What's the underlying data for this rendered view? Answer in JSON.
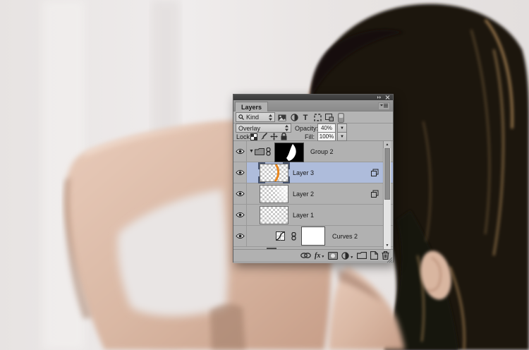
{
  "panel": {
    "tab": "Layers",
    "titlebar": {
      "collapse_icon": "double-arrow-icon",
      "close_icon": "x-icon"
    },
    "panel_menu_icon": "panel-menu-icon",
    "filter": {
      "kind_label": "Kind",
      "search_icon": "magnifier-icon",
      "type_filters": [
        "pixel-layers-filter",
        "adjustment-layers-filter",
        "type-layers-filter",
        "shape-layers-filter",
        "smart-objects-filter"
      ],
      "toggle_icon": "filtering-toggle"
    },
    "blend": {
      "mode": "Overlay"
    },
    "opacity": {
      "label": "Opacity:",
      "value": "40%"
    },
    "lock": {
      "label": "Lock:",
      "buttons": [
        "lock-transparent-pixels",
        "lock-image-pixels",
        "lock-position",
        "lock-all"
      ]
    },
    "fill": {
      "label": "Fill:",
      "value": "100%"
    },
    "layers": [
      {
        "name": "Group 2",
        "type": "group",
        "visible": true,
        "expanded": true,
        "mask": "black-with-white-profile",
        "mask_linked": true
      },
      {
        "name": "Layer 3",
        "type": "pixel",
        "visible": true,
        "selected": true,
        "has_badge": true,
        "thumbnail": "transparent-with-orange-stroke"
      },
      {
        "name": "Layer 2",
        "type": "pixel",
        "visible": true,
        "has_badge": true,
        "thumbnail": "transparent-faint-white"
      },
      {
        "name": "Layer 1",
        "type": "pixel",
        "visible": true,
        "has_badge": false,
        "thumbnail": "transparent"
      },
      {
        "name": "Curves 2",
        "type": "curves-adjustment",
        "visible": true,
        "mask": "white",
        "mask_linked": true
      }
    ],
    "bottom_toolbar": {
      "fx_label": "fx",
      "icons": [
        "link-layers",
        "layer-styles",
        "add-layer-mask",
        "new-adjustment-layer",
        "new-group",
        "new-layer",
        "delete-layer"
      ]
    }
  },
  "colors": {
    "selection_blue": "#aebcdb",
    "panel_gray": "#b1b1b1",
    "titlebar_gray": "#404040",
    "thumbnail_stroke_orange": "#e8851c"
  }
}
